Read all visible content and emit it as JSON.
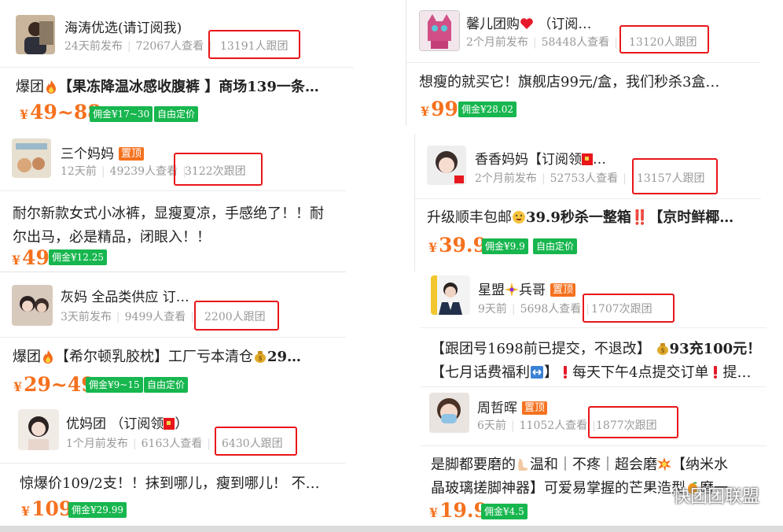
{
  "left": [
    {
      "name": "海涛优选(请订阅我)",
      "time": "24天前发布",
      "views": "72067人查看",
      "follow": "13191人跟团",
      "desc_prefix": "爆团",
      "desc": "【果冻降温冰感收腹裤 】商场139一条…",
      "price": "49~88",
      "tags": [
        "佣金¥17~30",
        "自由定价"
      ]
    },
    {
      "name": "三个妈妈",
      "badge": "置顶",
      "time": "12天前",
      "views": "49239人查看",
      "follow": "3122次跟团",
      "desc_line1": "耐尔新款女式小冰裤，显瘦夏凉，手感绝了！！耐",
      "desc_line2": "尔出马，必是精品，闭眼入！！",
      "price": "49",
      "tags": [
        "佣金¥12.25"
      ]
    },
    {
      "name": "灰妈 全品类供应 订…",
      "time": "3天前发布",
      "views": "9499人查看",
      "follow": "2200人跟团",
      "desc_prefix": "爆团",
      "desc": "【希尔顿乳胶枕】工厂亏本清仓",
      "desc_suffix": "29…",
      "price": "29~49",
      "tags": [
        "佣金¥9~15",
        "自由定价"
      ]
    },
    {
      "name": "优妈团 （订阅领",
      "name_suffix": "）",
      "time": "1个月前发布",
      "views": "6163人查看",
      "follow": "6430人跟团",
      "desc": "惊爆价109/2支！！抹到哪儿，瘦到哪儿！ 不…",
      "price": "109",
      "tags": [
        "佣金¥29.99"
      ]
    }
  ],
  "right": [
    {
      "name": "馨儿团购",
      "name_suffix": "（订阅…",
      "time": "2个月前发布",
      "views": "58448人查看",
      "follow": "13120人跟团",
      "desc": "想瘦的就买它！旗舰店99元/盒，我们秒杀3盒…",
      "price": "99",
      "tags": [
        "佣金¥28.02"
      ]
    },
    {
      "name": "香香妈妈【订阅领",
      "name_suffix": "…",
      "time": "2个月前发布",
      "views": "52753人查看",
      "follow": "13157人跟团",
      "desc_prefix": "升级顺丰包邮",
      "desc": "39.9秒杀一整箱‼️【京时鲜椰…",
      "price": "39.9",
      "tags": [
        "佣金¥9.9",
        "自由定价"
      ]
    },
    {
      "name_prefix": "星盟",
      "name": "兵哥",
      "badge": "置顶",
      "time": "9天前",
      "views": "5698人查看",
      "follow": "1707次跟团",
      "desc_line1": "【跟团号1698前已提交，不退改】",
      "desc_line1b": "93充100元！",
      "desc_line2": "【七月话费福利",
      "desc_line2b": "】",
      "desc_line2c": "每天下午4点提交订单",
      "desc_line2d": "提…"
    },
    {
      "name": "周哲晖",
      "badge": "置顶",
      "time": "6天前",
      "views": "11052人查看",
      "follow": "1877次跟团",
      "desc_line1": "是脚都要磨的",
      "desc_line1b": "温和｜不疼｜超会磨",
      "desc_line1c": "【纳米水",
      "desc_line2": "晶玻璃搓脚神器】可爱易掌握的芒果造型",
      "desc_line2b": "磨一",
      "price": "19.9",
      "tags": [
        "佣金¥4.5"
      ]
    }
  ],
  "watermark": "快团团联盟",
  "colors": {
    "price": "#f5711e",
    "tag": "#17b64e",
    "highlight_box": "#e8161a",
    "badge": "#f5711e"
  }
}
